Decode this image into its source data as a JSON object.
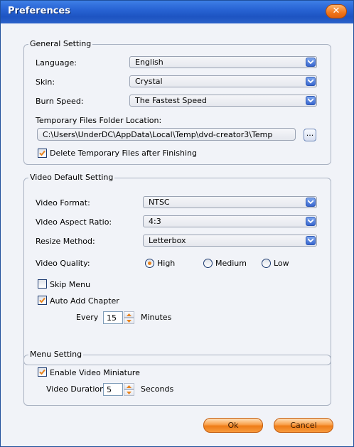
{
  "window": {
    "title": "Preferences",
    "close_icon": "close-icon"
  },
  "general": {
    "group_title": "General Setting",
    "language_label": "Language:",
    "language_value": "English",
    "skin_label": "Skin:",
    "skin_value": "Crystal",
    "burn_label": "Burn Speed:",
    "burn_value": "The Fastest Speed",
    "temp_label": "Temporary Files Folder Location:",
    "temp_path": "C:\\Users\\UnderDC\\AppData\\Local\\Temp\\dvd-creator3\\Temp",
    "browse_label": "...",
    "delete_label": "Delete Temporary Files after Finishing",
    "delete_checked": true
  },
  "video": {
    "group_title": "Video Default Setting",
    "format_label": "Video Format:",
    "format_value": "NTSC",
    "aspect_label": "Video Aspect Ratio:",
    "aspect_value": "4:3",
    "resize_label": "Resize Method:",
    "resize_value": "Letterbox",
    "quality_label": "Video Quality:",
    "quality_options": [
      "High",
      "Medium",
      "Low"
    ],
    "quality_selected": "High",
    "skip_menu_label": "Skip Menu",
    "skip_menu_checked": false,
    "auto_chapter_label": "Auto Add Chapter",
    "auto_chapter_checked": true,
    "every_label": "Every",
    "every_value": "15",
    "minutes_label": "Minutes"
  },
  "menu": {
    "group_title": "Menu Setting",
    "miniature_label": "Enable Video Miniature",
    "miniature_checked": true,
    "duration_label": "Video Duration",
    "duration_value": "5",
    "seconds_label": "Seconds"
  },
  "buttons": {
    "ok": "Ok",
    "cancel": "Cancel"
  },
  "colors": {
    "title_bar": "#2a66d6",
    "accent_orange": "#ee7c18",
    "check_mark": "#e8821c"
  }
}
